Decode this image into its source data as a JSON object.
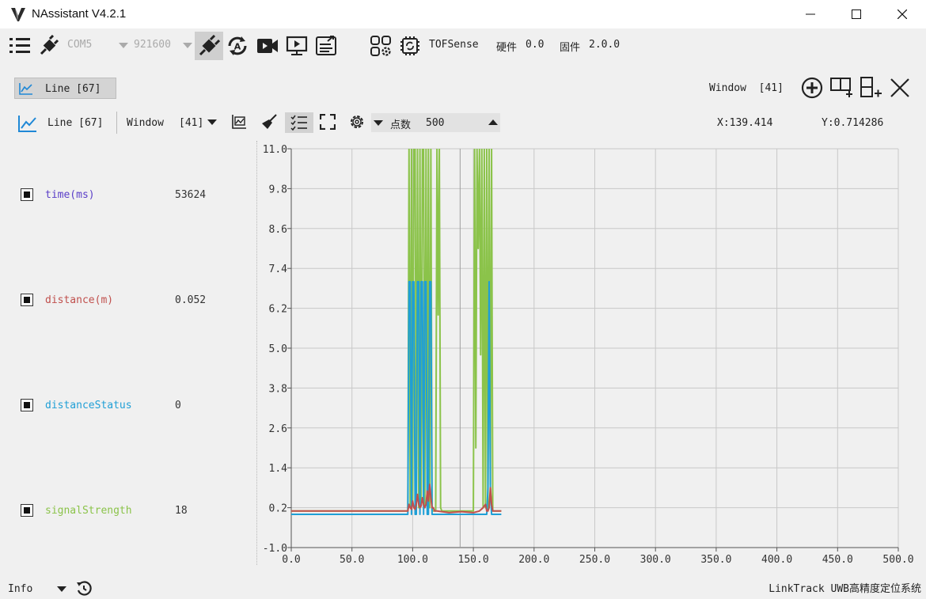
{
  "window": {
    "title": "NAssistant V4.2.1"
  },
  "toolbar": {
    "port": "COM5",
    "baud": "921600",
    "device": "TOFSense",
    "hardware_label": "硬件",
    "hardware_version": "0.0",
    "firmware_label": "固件",
    "firmware_version": "2.0.0"
  },
  "tabs": [
    {
      "label": "Line [67]",
      "active": true
    }
  ],
  "tab_strip": {
    "window_label": "Window",
    "window_value": "[41]"
  },
  "chart_header": {
    "line_label": "Line [67]",
    "window_label": "Window",
    "window_value": "[41]",
    "points_label": "点数",
    "points_value": "500",
    "cursor_x": "X:139.414",
    "cursor_y": "Y:0.714286"
  },
  "legend": [
    {
      "name": "time(ms)",
      "value": "53624",
      "color": "#5a3ec8"
    },
    {
      "name": "distance(m)",
      "value": "0.052",
      "color": "#c0504d"
    },
    {
      "name": "distanceStatus",
      "value": "0",
      "color": "#1f9fd6"
    },
    {
      "name": "signalStrength",
      "value": "18",
      "color": "#8bc34a"
    }
  ],
  "chart_data": {
    "type": "line",
    "x_ticks": [
      "0.0",
      "50.0",
      "100.0",
      "150.0",
      "200.0",
      "250.0",
      "300.0",
      "350.0",
      "400.0",
      "450.0",
      "500.0"
    ],
    "y_ticks": [
      "11.0",
      "9.8",
      "8.6",
      "7.4",
      "6.2",
      "5.0",
      "3.8",
      "2.6",
      "1.4",
      "0.2",
      "-1.0"
    ],
    "xlim": [
      0,
      500
    ],
    "ylim": [
      -1,
      11
    ],
    "grid": true,
    "series": [
      {
        "name": "signalStrength",
        "color": "#8bc34a",
        "x": [
          0,
          96,
          97,
          98,
          99,
          100,
          101,
          102,
          103,
          104,
          105,
          106,
          107,
          108,
          109,
          110,
          111,
          112,
          113,
          114,
          115,
          116,
          117,
          118,
          119,
          120,
          121,
          122,
          123,
          124,
          125,
          150,
          151,
          152,
          153,
          154,
          155,
          156,
          157,
          158,
          159,
          160,
          161,
          162,
          163,
          164,
          165,
          166,
          167,
          168,
          169,
          170,
          171,
          172,
          173
        ],
        "y": [
          0.1,
          0.1,
          11,
          0.2,
          11,
          0.3,
          11,
          11,
          0.2,
          11,
          0.2,
          11,
          0.3,
          11,
          11,
          0.2,
          11,
          0.3,
          11,
          0.2,
          11,
          0.1,
          0.1,
          0.1,
          0.1,
          11,
          6,
          11,
          0.2,
          0.1,
          0.1,
          0.1,
          11,
          2,
          11,
          8,
          11,
          4.8,
          11,
          0.2,
          11,
          0.2,
          11,
          0.1,
          11,
          0.9,
          11,
          0.1,
          0.1,
          0.1,
          0.1,
          0.1,
          0.1,
          0.1,
          0.1
        ]
      },
      {
        "name": "distanceStatus",
        "color": "#1f9fd6",
        "x": [
          0,
          95,
          96,
          97,
          98,
          99,
          100,
          101,
          102,
          103,
          104,
          105,
          106,
          107,
          108,
          109,
          110,
          111,
          112,
          113,
          114,
          115,
          116,
          117,
          118,
          160,
          161,
          162,
          163,
          164,
          165,
          166,
          167,
          168,
          169,
          170,
          171,
          172,
          173
        ],
        "y": [
          0,
          0,
          0,
          7,
          7,
          0,
          7,
          7,
          0,
          0,
          7,
          7,
          0,
          7,
          7,
          0,
          7,
          7,
          0,
          0,
          7,
          7,
          0,
          0,
          0,
          0,
          0,
          0.8,
          7,
          0.8,
          0,
          0,
          0,
          0,
          0,
          0,
          0,
          0,
          0
        ]
      },
      {
        "name": "distance(m)",
        "color": "#c0504d",
        "x": [
          0,
          95,
          96,
          97,
          98,
          99,
          100,
          101,
          102,
          103,
          104,
          105,
          106,
          107,
          108,
          109,
          110,
          111,
          112,
          113,
          114,
          115,
          116,
          117,
          118,
          119,
          120,
          130,
          140,
          150,
          155,
          158,
          160,
          161,
          162,
          163,
          164,
          165,
          166,
          167,
          168,
          169,
          170,
          171,
          172,
          173
        ],
        "y": [
          0.1,
          0.1,
          0.1,
          0.3,
          0.2,
          0.15,
          0.4,
          0.2,
          0.15,
          0.3,
          0.6,
          0.3,
          0.2,
          0.25,
          0.5,
          0.3,
          0.2,
          0.3,
          0.7,
          0.4,
          0.9,
          0.5,
          0.2,
          0.2,
          0.1,
          0.1,
          0.1,
          0.05,
          0.08,
          0.05,
          0.1,
          0.2,
          0.3,
          0.1,
          0.1,
          0.2,
          0.8,
          0.3,
          0.1,
          0.1,
          0.1,
          0.1,
          0.1,
          0.1,
          0.1,
          0.1
        ]
      }
    ]
  },
  "statusbar": {
    "level": "Info",
    "right_text": "LinkTrack UWB高精度定位系统"
  }
}
